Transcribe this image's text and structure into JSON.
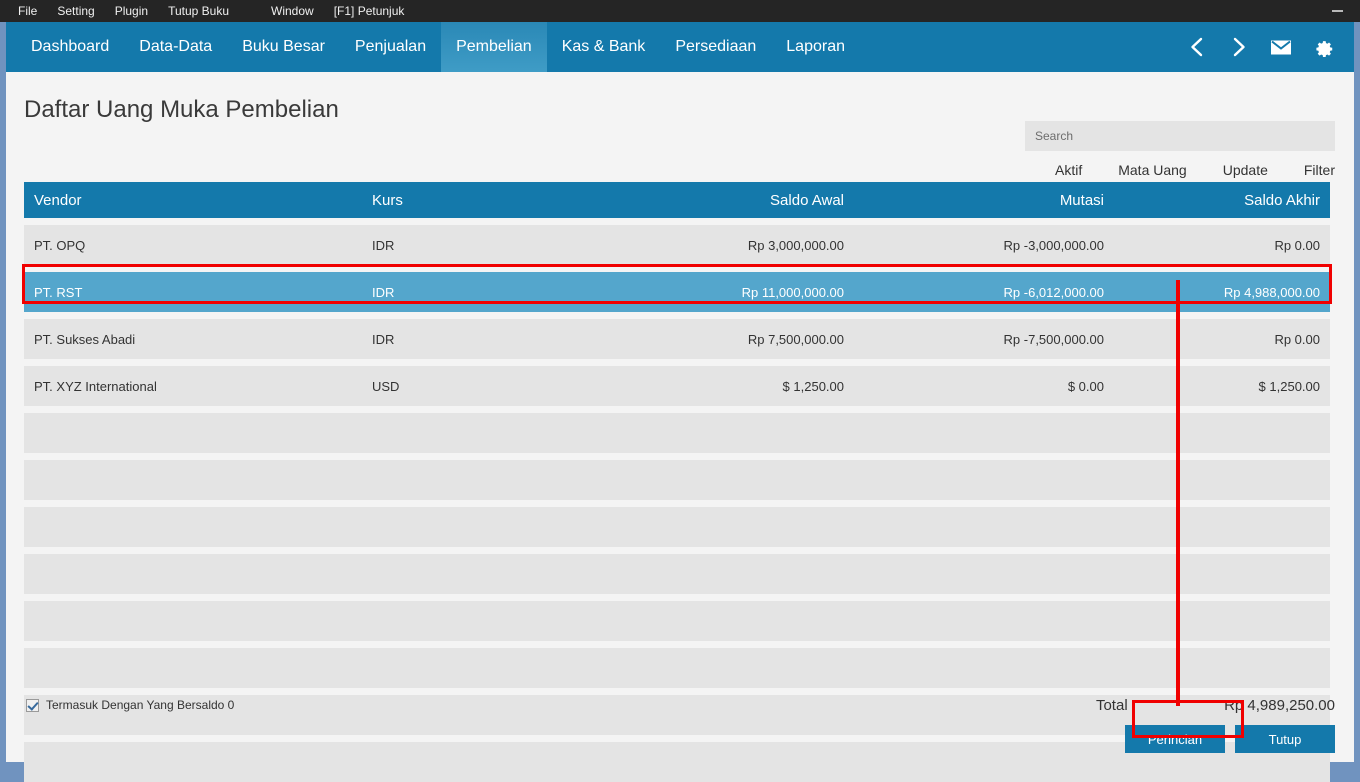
{
  "window": {
    "minimize_icon": "minimize-icon"
  },
  "menubar": {
    "items": [
      {
        "label": "File"
      },
      {
        "label": "Setting"
      },
      {
        "label": "Plugin"
      },
      {
        "label": "Tutup Buku"
      },
      {
        "label": "Window"
      },
      {
        "label": "[F1] Petunjuk"
      }
    ]
  },
  "nav": {
    "tabs": [
      {
        "label": "Dashboard",
        "active": false
      },
      {
        "label": "Data-Data",
        "active": false
      },
      {
        "label": "Buku Besar",
        "active": false
      },
      {
        "label": "Penjualan",
        "active": false
      },
      {
        "label": "Pembelian",
        "active": true
      },
      {
        "label": "Kas & Bank",
        "active": false
      },
      {
        "label": "Persediaan",
        "active": false
      },
      {
        "label": "Laporan",
        "active": false
      }
    ],
    "icons": [
      {
        "name": "chevron-left-icon"
      },
      {
        "name": "chevron-right-icon"
      },
      {
        "name": "envelope-icon"
      },
      {
        "name": "gear-icon"
      }
    ]
  },
  "page": {
    "title": "Daftar Uang Muka Pembelian"
  },
  "search": {
    "placeholder": "Search",
    "value": ""
  },
  "toolbar": {
    "links": [
      {
        "label": "Aktif"
      },
      {
        "label": "Mata Uang"
      },
      {
        "label": "Update"
      },
      {
        "label": "Filter"
      }
    ]
  },
  "table": {
    "columns": [
      {
        "label": "Vendor"
      },
      {
        "label": "Kurs"
      },
      {
        "label": "Saldo Awal"
      },
      {
        "label": "Mutasi"
      },
      {
        "label": "Saldo Akhir"
      }
    ],
    "rows": [
      {
        "vendor": "PT. OPQ",
        "kurs": "IDR",
        "saldo_awal": "Rp 3,000,000.00",
        "mutasi": "Rp -3,000,000.00",
        "saldo_akhir": "Rp 0.00",
        "selected": false
      },
      {
        "vendor": "PT. RST",
        "kurs": "IDR",
        "saldo_awal": "Rp 11,000,000.00",
        "mutasi": "Rp -6,012,000.00",
        "saldo_akhir": "Rp 4,988,000.00",
        "selected": true
      },
      {
        "vendor": "PT. Sukses Abadi",
        "kurs": "IDR",
        "saldo_awal": "Rp 7,500,000.00",
        "mutasi": "Rp -7,500,000.00",
        "saldo_akhir": "Rp 0.00",
        "selected": false
      },
      {
        "vendor": "PT. XYZ International",
        "kurs": "USD",
        "saldo_awal": "$ 1,250.00",
        "mutasi": "$ 0.00",
        "saldo_akhir": "$ 1,250.00",
        "selected": false
      }
    ],
    "empty_row_count": 8
  },
  "footer": {
    "checkbox_label": "Termasuk Dengan Yang Bersaldo 0",
    "checkbox_checked": true,
    "total_label": "Total :",
    "total_value": "Rp 4,989,250.00",
    "buttons": [
      {
        "label": "Perincian",
        "highlighted": true
      },
      {
        "label": "Tutup",
        "highlighted": false
      }
    ]
  },
  "colors": {
    "accent": "#1479ab",
    "selected_row": "#54a6cc",
    "annotation": "#f00000",
    "menubar": "#252525",
    "window_border": "#7093bf",
    "page_bg": "#f4f4f4",
    "row_bg": "#e4e4e4"
  }
}
